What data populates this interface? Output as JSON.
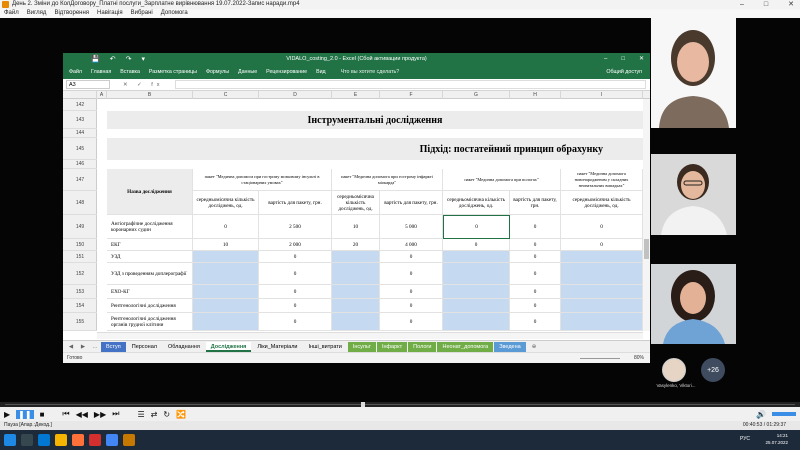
{
  "player": {
    "title": "День 2. Зміни до КолДоговору_Платні послуги_Зарплатне вирівнювання 19.07.2022-Запис наради.mp4",
    "menu": [
      "Файл",
      "Вигляд",
      "Відтворення",
      "Навігація",
      "Вибрані",
      "Допомога"
    ],
    "window_controls": [
      "–",
      "□",
      "✕"
    ],
    "status": "Пауза [Апар.:Декод.]",
    "time": "00:40:53 / 01:29:37"
  },
  "excel": {
    "window_title": "VIDALO_costing_2.0 - Excel (Сбой активации продукта)",
    "quick_access": [
      "💾",
      "↶",
      "↷",
      "▾"
    ],
    "ribbon_tabs": [
      "Файл",
      "Главная",
      "Вставка",
      "Разметка страницы",
      "Формулы",
      "Данные",
      "Рецензирование",
      "Вид"
    ],
    "tell_me": "Что вы хотите сделать?",
    "share": "Общий доступ",
    "name_box": "A3",
    "fx_label": "✕ ✓ fx",
    "columns": [
      "A",
      "B",
      "C",
      "D",
      "E",
      "F",
      "G",
      "H",
      "I"
    ],
    "row_numbers": [
      "142",
      "143",
      "144",
      "145",
      "146",
      "147",
      "148",
      "149",
      "150",
      "151",
      "152",
      "153",
      "154",
      "155"
    ],
    "section_title": "Інструментальні дослідження",
    "approach_title": "Підхід: постатейний принцип обрахунку",
    "table": {
      "col_name": "Назва дослідження",
      "packages": [
        "пакет \"Медична допомога при гострому мозковому інсульті в стаціонарних умовах\"",
        "пакет \"Медична допомога при гострому інфаркті міокарда\"",
        "пакет \"Медична допомога при пологах\"",
        "пакет \"Медична допомога новонародженим у складних неонатальних випадках\""
      ],
      "sub_avg_count": "середньомісячна кількість досліджень, од.",
      "sub_avg_count_short": "середньомісячна кількість досліджень, од.",
      "sub_price": "вартість для пакету, грн.",
      "sub_price_short": "вартість для пакету, грн.",
      "rows": [
        {
          "name": "Ангіографічне дослідження коронарних судин",
          "c": "0",
          "d": "2 500",
          "e": "10",
          "f": "5 000",
          "g": "0",
          "h": "0",
          "i": "0"
        },
        {
          "name": "ЕКГ",
          "c": "10",
          "d": "2 000",
          "e": "20",
          "f": "4 000",
          "g": "0",
          "h": "0",
          "i": "0"
        },
        {
          "name": "УЗД",
          "c": "",
          "d": "0",
          "e": "",
          "f": "0",
          "g": "",
          "h": "0",
          "i": ""
        },
        {
          "name": "УЗД з проведенням доплерографії",
          "c": "",
          "d": "0",
          "e": "",
          "f": "0",
          "g": "",
          "h": "0",
          "i": ""
        },
        {
          "name": "ЕХО-КГ",
          "c": "",
          "d": "0",
          "e": "",
          "f": "0",
          "g": "",
          "h": "0",
          "i": ""
        },
        {
          "name": "Рентгенологічні дослідження",
          "c": "",
          "d": "0",
          "e": "",
          "f": "0",
          "g": "",
          "h": "0",
          "i": ""
        },
        {
          "name": "Рентгенологічні дослідження органів грудної клітини",
          "c": "",
          "d": "0",
          "e": "",
          "f": "0",
          "g": "",
          "h": "0",
          "i": ""
        }
      ]
    },
    "sheet_nav": [
      "◀",
      "▶",
      "..."
    ],
    "sheets": [
      {
        "label": "Вступ",
        "color": "#4472c4"
      },
      {
        "label": "Персонал",
        "color": ""
      },
      {
        "label": "Обладнання",
        "color": ""
      },
      {
        "label": "Дослідження",
        "color": "",
        "active": true
      },
      {
        "label": "Ліки_Матеріали",
        "color": ""
      },
      {
        "label": "Інші_витрати",
        "color": ""
      },
      {
        "label": "Інсульт",
        "color": "#70ad47"
      },
      {
        "label": "Інфаркт",
        "color": "#70ad47"
      },
      {
        "label": "Пологи",
        "color": "#70ad47"
      },
      {
        "label": "Неонат_допомога",
        "color": "#70ad47"
      },
      {
        "label": "Зведена",
        "color": "#5b9bd5"
      }
    ],
    "add_sheet": "⊕",
    "status_ready": "Готово",
    "zoom": "80%"
  },
  "participants": {
    "avatar_name": "Vasylenko, Viktori...",
    "more_count": "+26"
  },
  "controls": [
    "▶",
    "❚❚",
    "■",
    "⏮",
    "◀◀",
    "▶▶",
    "⏭",
    "☰",
    "⇄",
    "↻",
    "🔀"
  ],
  "volume_icon": "🔊",
  "taskbar": {
    "lang": "РУС",
    "time": "14:21",
    "date": "25.07.2022"
  }
}
